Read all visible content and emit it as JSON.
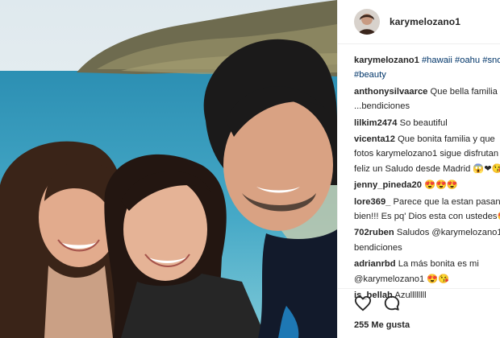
{
  "post": {
    "username": "karymelozano1",
    "avatar_icon": "profile-avatar",
    "photo_icon": "family-selfie-beach-photo"
  },
  "caption": {
    "user": "karymelozano1",
    "tags": [
      "#hawaii",
      "#oahu",
      "#snorkel",
      "#beauty"
    ],
    "line1_tags": "#hawaii #oahu #sno",
    "line2_tags": "#beauty"
  },
  "comments": [
    {
      "user": "anthonysilvaarce",
      "line1": "Que bella familia",
      "line2": "...bendiciones"
    },
    {
      "user": "lilkim2474",
      "line1": "So beautiful",
      "line2": ""
    },
    {
      "user": "vicenta12",
      "line1": "Que bonita familia y que",
      "line2": "fotos karymelozano1 sigue disfrutan",
      "line3": "feliz un Saludo desde Madrid 😱❤😘"
    },
    {
      "user": "jenny_pineda20",
      "line1": "😍😍😍",
      "line2": ""
    },
    {
      "user": "lore369_",
      "line1": "Parece que la estan pasano",
      "line2": "bien!!! Es pq' Dios esta con ustedes😍"
    },
    {
      "user": "702ruben",
      "line1": "Saludos @karymelozano1",
      "line2": "bendiciones"
    },
    {
      "user": "adrianrbd",
      "line1": "La más bonita es mi",
      "line2": "@karymelozano1 😍😘"
    },
    {
      "user": "is_bellah",
      "line1": "Azullllllll",
      "line2": ""
    }
  ],
  "actions": {
    "like_icon": "heart-icon",
    "comment_icon": "comment-icon"
  },
  "likes": "255 Me gusta",
  "colors": {
    "text": "#262626",
    "link": "#003569",
    "divider": "#efefef"
  }
}
